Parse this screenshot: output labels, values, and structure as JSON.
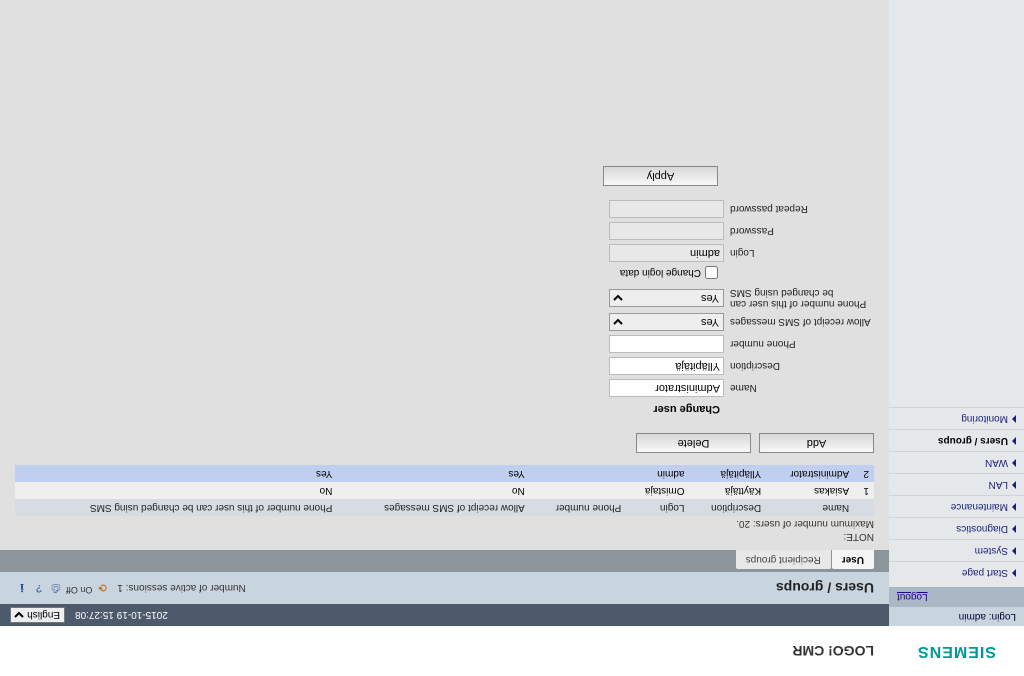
{
  "brand": "SIEMENS",
  "product": "LOGO! CMR",
  "loginText": "Login: admin",
  "logout": "Logout",
  "datetime": "2015-10-19  15:27:08",
  "language": "English",
  "pageTitle": "Users / groups",
  "sessionsLabel": "Number of active sessions: 1",
  "onOff": "On Off",
  "nav": [
    {
      "label": "Start page"
    },
    {
      "label": "System"
    },
    {
      "label": "Diagnostics"
    },
    {
      "label": "Maintenance"
    },
    {
      "label": "LAN"
    },
    {
      "label": "WAN"
    },
    {
      "label": "Users / groups",
      "active": true
    },
    {
      "label": "Monitoring"
    }
  ],
  "tabs": [
    {
      "label": "User",
      "active": true
    },
    {
      "label": "Recipient groups"
    }
  ],
  "noteLabel": "NOTE:",
  "maxNote": "Maximum number of users: 20.",
  "table": {
    "headers": [
      "",
      "Name",
      "Description",
      "Login",
      "Phone number",
      "Allow receipt of SMS messages",
      "Phone number of this user can be changed using SMS"
    ],
    "rows": [
      {
        "n": "1",
        "name": "Asiakas",
        "desc": "Käyttäjä",
        "login": "Omistaja",
        "phone": "",
        "allow": "No",
        "chg": "No"
      },
      {
        "n": "2",
        "name": "Administrator",
        "desc": "Ylläpitäjä",
        "login": "admin",
        "phone": "",
        "allow": "Yes",
        "chg": "Yes"
      }
    ]
  },
  "buttons": {
    "add": "Add",
    "delete": "Delete",
    "apply": "Apply"
  },
  "form": {
    "sectionTitle": "Change user",
    "nameLabel": "Name",
    "nameVal": "Administrator",
    "descLabel": "Description",
    "descVal": "Ylläpitäjä",
    "phoneLabel": "Phone number",
    "phoneVal": "",
    "allowLabel": "Allow receipt of SMS messages",
    "allowVal": "Yes",
    "chgLabel": "Phone number of this user can be changed using SMS",
    "chgVal": "Yes",
    "changeLogin": "Change login data",
    "loginLabel": "Login",
    "loginVal": "admin",
    "pwLabel": "Password",
    "rpwLabel": "Repeat password"
  }
}
